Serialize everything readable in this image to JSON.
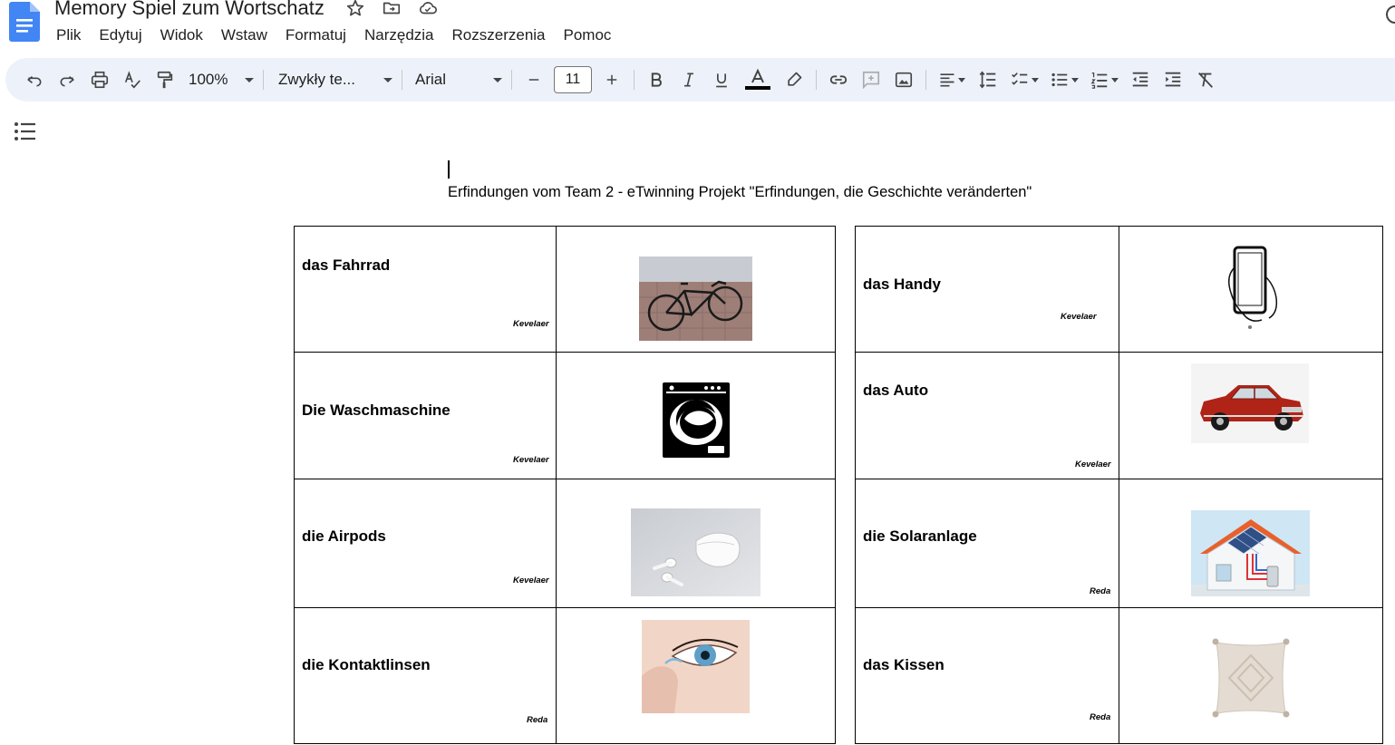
{
  "doc": {
    "title": "Memory Spiel zum Wortschatz",
    "heading": "Erfindungen vom Team 2 - eTwinning Projekt \"Erfindungen, die Geschichte veränderten\""
  },
  "menu": [
    "Plik",
    "Edytuj",
    "Widok",
    "Wstaw",
    "Formatuj",
    "Narzędzia",
    "Rozszerzenia",
    "Pomoc"
  ],
  "toolbar": {
    "zoom": "100%",
    "style": "Zwykły te...",
    "font": "Arial",
    "font_size": "11",
    "text_color": "#000000"
  },
  "colors": {
    "docs_blue": "#4285f4",
    "toolbar_bg": "#edf2fa"
  },
  "rows": [
    {
      "left_word": "das Fahrrad",
      "left_author": "Kevelaer",
      "right_word": "das Handy",
      "right_author": "Kevelaer"
    },
    {
      "left_word": "Die Waschmaschine",
      "left_author": "Kevelaer",
      "right_word": "das Auto",
      "right_author": "Kevelaer"
    },
    {
      "left_word": "die Airpods",
      "left_author": "Kevelaer",
      "right_word": "die Solaranlage",
      "right_author": "Reda"
    },
    {
      "left_word": "die Kontaktlinsen",
      "left_author": "Reda",
      "right_word": "das Kissen",
      "right_author": "Reda"
    }
  ]
}
